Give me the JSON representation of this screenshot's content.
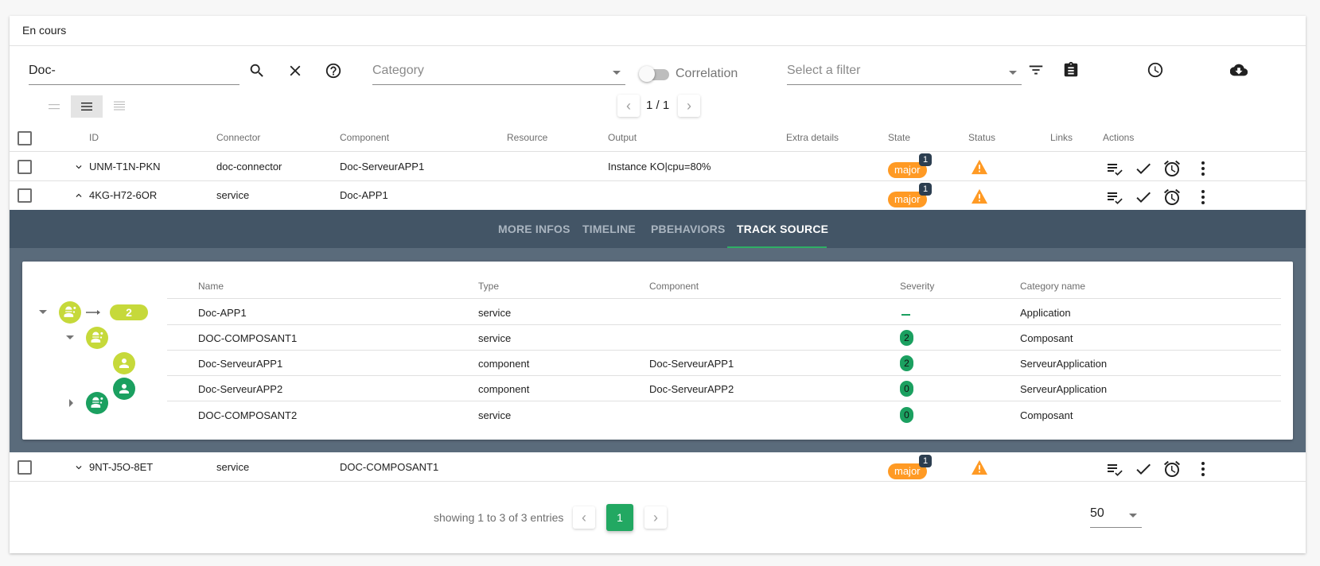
{
  "card": {
    "title": "En cours"
  },
  "toolbar": {
    "search": {
      "value": "Doc-"
    },
    "search_icon": "search-icon",
    "clear_icon": "close-icon",
    "help_icon": "help-circle-icon",
    "category": {
      "placeholder": "Category"
    },
    "correlation": {
      "label": "Correlation",
      "enabled": false
    },
    "filter": {
      "placeholder": "Select a filter"
    },
    "icons": [
      "filter-list-icon",
      "clipboard-icon",
      "clock-icon",
      "cloud-download-icon"
    ],
    "density": {
      "options": [
        "compact",
        "normal",
        "comfortable"
      ],
      "selected": "normal"
    },
    "pagination": {
      "text": "1 / 1"
    }
  },
  "table": {
    "headers": [
      "ID",
      "Connector",
      "Component",
      "Resource",
      "Output",
      "Extra details",
      "State",
      "Status",
      "Links",
      "Actions"
    ],
    "rows": [
      {
        "id": "UNM-T1N-PKN",
        "connector": "doc-connector",
        "component": "Doc-ServeurAPP1",
        "resource": "",
        "output": "Instance KO|cpu=80%",
        "state": "major",
        "state_count": "1",
        "status": "warning",
        "expanded": false
      },
      {
        "id": "4KG-H72-6OR",
        "connector": "service",
        "component": "Doc-APP1",
        "resource": "",
        "output": "",
        "state": "major",
        "state_count": "1",
        "status": "warning",
        "expanded": true
      },
      {
        "id": "9NT-J5O-8ET",
        "connector": "service",
        "component": "DOC-COMPOSANT1",
        "resource": "",
        "output": "",
        "state": "major",
        "state_count": "1",
        "status": "warning",
        "expanded": false
      }
    ],
    "row_actions": [
      "ack-icon",
      "fast-ack-icon",
      "snooze-icon",
      "more-vert-icon"
    ]
  },
  "details": {
    "tabs": [
      "MORE INFOS",
      "TIMELINE",
      "PBEHAVIORS",
      "TRACK SOURCE"
    ],
    "active_tab": "TRACK SOURCE",
    "tree_root_count": "2",
    "headers": [
      "Name",
      "Type",
      "Component",
      "Severity",
      "Category name"
    ],
    "rows": [
      {
        "name": "Doc-APP1",
        "type": "service",
        "component": "",
        "severity": "–",
        "category": "Application"
      },
      {
        "name": "DOC-COMPOSANT1",
        "type": "service",
        "component": "",
        "severity": "2",
        "category": "Composant"
      },
      {
        "name": "Doc-ServeurAPP1",
        "type": "component",
        "component": "Doc-ServeurAPP1",
        "severity": "2",
        "category": "ServeurApplication"
      },
      {
        "name": "Doc-ServeurAPP2",
        "type": "component",
        "component": "Doc-ServeurAPP2",
        "severity": "0",
        "category": "ServeurApplication"
      },
      {
        "name": "DOC-COMPOSANT2",
        "type": "service",
        "component": "",
        "severity": "0",
        "category": "Composant"
      }
    ]
  },
  "footer": {
    "showing": "showing 1 to 3 of 3 entries",
    "current_page": "1",
    "per_page": "50"
  },
  "colors": {
    "major": "#ff9a24",
    "ok_green": "#1ba060",
    "lime": "#c6d93a",
    "accent": "#22a862",
    "band_dark": "#435566",
    "band": "#5a6b7b"
  }
}
